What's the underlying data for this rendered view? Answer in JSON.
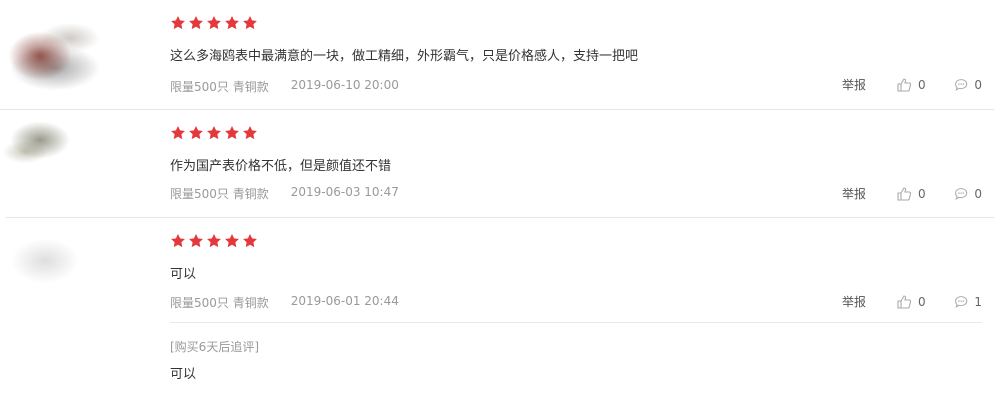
{
  "reviews": [
    {
      "rating": 5,
      "content": "这么多海鸥表中最满意的一块，做工精细，外形霸气，只是价格感人，支持一把吧",
      "spec": "限量500只 青铜款",
      "date": "2019-06-10 20:00",
      "report_label": "举报",
      "likes": "0",
      "comments": "0"
    },
    {
      "rating": 5,
      "content": "作为国产表价格不低，但是颜值还不错",
      "spec": "限量500只 青铜款",
      "date": "2019-06-03 10:47",
      "report_label": "举报",
      "likes": "0",
      "comments": "0"
    },
    {
      "rating": 5,
      "content": "可以",
      "spec": "限量500只 青铜款",
      "date": "2019-06-01 20:44",
      "report_label": "举报",
      "likes": "0",
      "comments": "1",
      "followup": {
        "tag": "[购买6天后追评]",
        "content": "可以"
      }
    }
  ],
  "colors": {
    "star": "#e4393c",
    "meta_text": "#999999",
    "divider": "#e5e5e5"
  },
  "icons": {
    "star": "star-icon",
    "like": "thumbs-up-icon",
    "comment": "comment-bubble-icon"
  }
}
